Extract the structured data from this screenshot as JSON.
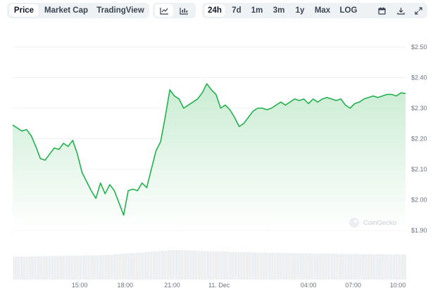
{
  "toolbar": {
    "metric_tabs": [
      "Price",
      "Market Cap",
      "TradingView"
    ],
    "range_tabs": [
      "24h",
      "7d",
      "1m",
      "3m",
      "1y",
      "Max",
      "LOG"
    ],
    "active_metric": "Price",
    "active_range": "24h",
    "chart_type_icons": [
      "line-chart-icon",
      "candlestick-chart-icon"
    ],
    "utility_icons": [
      "calendar-icon",
      "download-icon",
      "expand-icon"
    ]
  },
  "watermark": "CoinGecko",
  "colors": {
    "line": "#22b14c",
    "fill_top": "#c6ebd0",
    "grid": "#eef0f3",
    "volume": "#e3e6ea"
  },
  "chart_data": {
    "type": "area",
    "title": "",
    "ylabel": "",
    "xlabel": "",
    "y_tick_labels": [
      "$2.50",
      "$2.40",
      "$2.30",
      "$2.20",
      "$2.10",
      "$2.00",
      "$1.90"
    ],
    "y_ticks": [
      2.5,
      2.4,
      2.3,
      2.2,
      2.1,
      2.0,
      1.9
    ],
    "ylim": [
      1.9,
      2.5
    ],
    "x_tick_labels": [
      "15:00",
      "18:00",
      "21:00",
      "11. Dec",
      "04:00",
      "07:00",
      "10:00"
    ],
    "x_ticks_hours": [
      4.35,
      7.3,
      10.35,
      13.4,
      19.2,
      22.1,
      25.0
    ],
    "xlim_hours": [
      0,
      25.5
    ],
    "grid": true,
    "series": [
      {
        "x_hours": [
          0.0,
          0.3,
          0.6,
          0.9,
          1.2,
          1.5,
          1.8,
          2.1,
          2.4,
          2.7,
          3.0,
          3.3,
          3.6,
          3.9,
          4.2,
          4.5,
          4.8,
          5.1,
          5.4,
          5.7,
          6.0,
          6.3,
          6.6,
          6.9,
          7.2,
          7.5,
          7.8,
          8.1,
          8.4,
          8.7,
          9.0,
          9.3,
          9.6,
          9.9,
          10.2,
          10.5,
          10.8,
          11.1,
          11.4,
          11.7,
          12.0,
          12.3,
          12.6,
          12.9,
          13.2,
          13.5,
          13.8,
          14.1,
          14.4,
          14.7,
          15.0,
          15.3,
          15.6,
          15.9,
          16.2,
          16.5,
          16.8,
          17.1,
          17.4,
          17.7,
          18.0,
          18.3,
          18.6,
          18.9,
          19.2,
          19.5,
          19.8,
          20.1,
          20.4,
          20.7,
          21.0,
          21.3,
          21.6,
          21.9,
          22.2,
          22.5,
          22.8,
          23.1,
          23.4,
          23.7,
          24.0,
          24.3,
          24.6,
          24.9,
          25.2,
          25.5
        ],
        "values": [
          2.245,
          2.235,
          2.225,
          2.23,
          2.21,
          2.175,
          2.135,
          2.13,
          2.15,
          2.17,
          2.165,
          2.185,
          2.175,
          2.195,
          2.15,
          2.09,
          2.06,
          2.03,
          2.005,
          2.055,
          2.02,
          2.05,
          2.03,
          1.99,
          1.95,
          2.03,
          2.035,
          2.03,
          2.055,
          2.04,
          2.1,
          2.16,
          2.19,
          2.27,
          2.36,
          2.34,
          2.33,
          2.3,
          2.31,
          2.32,
          2.33,
          2.35,
          2.38,
          2.36,
          2.345,
          2.3,
          2.31,
          2.295,
          2.27,
          2.24,
          2.25,
          2.27,
          2.29,
          2.3,
          2.3,
          2.295,
          2.3,
          2.31,
          2.32,
          2.31,
          2.32,
          2.33,
          2.325,
          2.33,
          2.315,
          2.33,
          2.32,
          2.33,
          2.335,
          2.33,
          2.325,
          2.33,
          2.31,
          2.3,
          2.315,
          2.32,
          2.33,
          2.335,
          2.34,
          2.335,
          2.34,
          2.345,
          2.345,
          2.34,
          2.35,
          2.348
        ]
      }
    ],
    "volume": {
      "x_hours": [
        0.0,
        0.5,
        1.0,
        1.5,
        2.0,
        2.5,
        3.0,
        3.5,
        4.0,
        4.5,
        5.0,
        5.5,
        6.0,
        6.5,
        7.0,
        7.5,
        8.0,
        8.5,
        9.0,
        9.5,
        10.0,
        10.5,
        11.0,
        11.5,
        12.0,
        12.5,
        13.0,
        13.5,
        14.0,
        14.5,
        15.0,
        15.5,
        16.0,
        16.5,
        17.0,
        17.5,
        18.0,
        18.5,
        19.0,
        19.5,
        20.0,
        20.5,
        21.0,
        21.5,
        22.0,
        22.5,
        23.0,
        23.5,
        24.0,
        24.5,
        25.0
      ],
      "values": [
        0.78,
        0.78,
        0.79,
        0.79,
        0.8,
        0.8,
        0.8,
        0.81,
        0.81,
        0.82,
        0.82,
        0.83,
        0.84,
        0.86,
        0.88,
        0.9,
        0.92,
        0.94,
        0.96,
        0.98,
        1.0,
        1.0,
        0.99,
        0.98,
        0.97,
        0.96,
        0.95,
        0.95,
        0.94,
        0.93,
        0.93,
        0.92,
        0.92,
        0.91,
        0.91,
        0.9,
        0.9,
        0.89,
        0.89,
        0.88,
        0.88,
        0.88,
        0.87,
        0.87,
        0.87,
        0.86,
        0.86,
        0.86,
        0.85,
        0.85,
        0.85
      ]
    }
  }
}
